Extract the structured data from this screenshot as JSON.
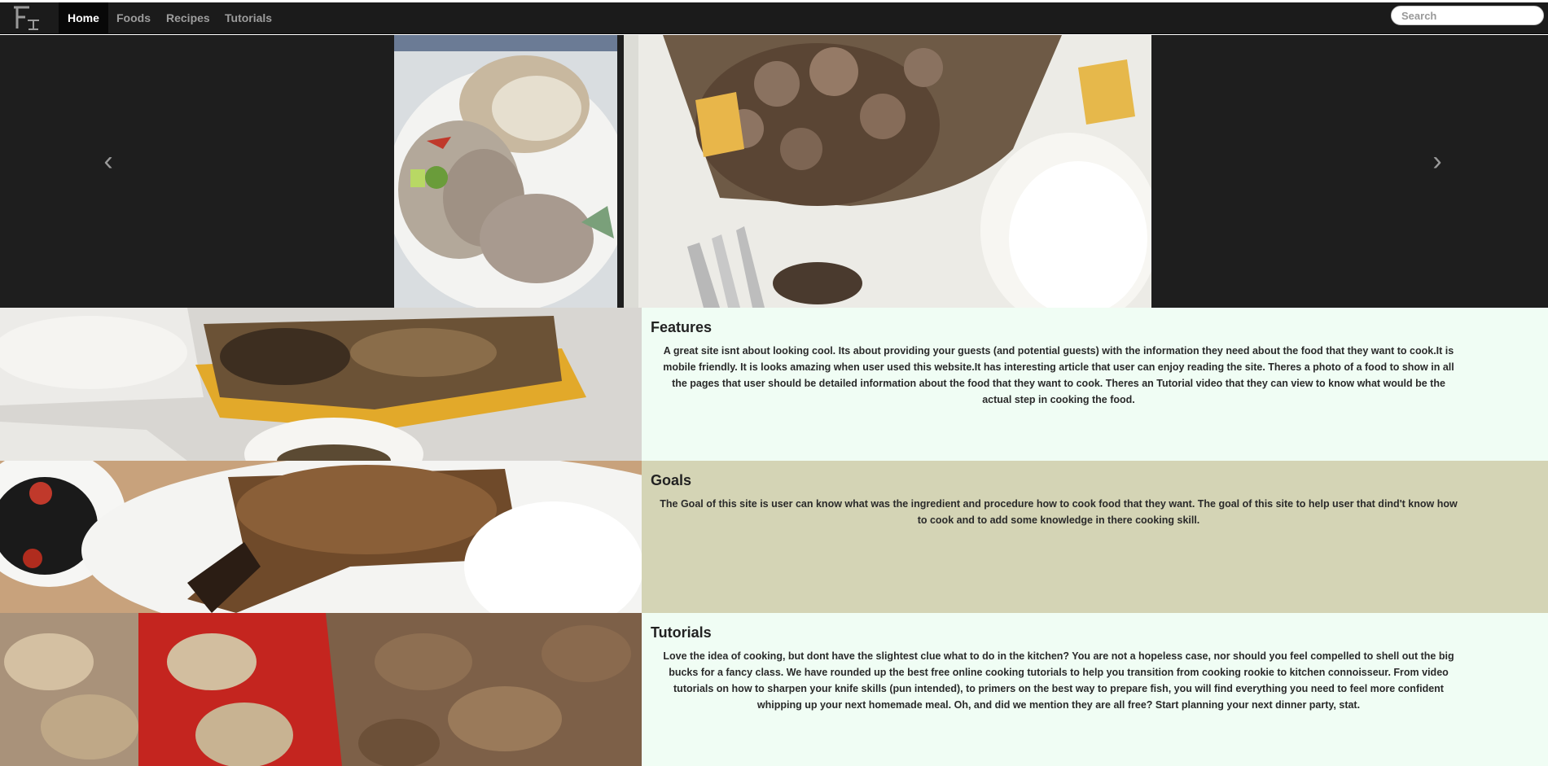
{
  "navbar": {
    "logo_icon": "fi-logo-icon",
    "items": [
      {
        "label": "Home",
        "active": true
      },
      {
        "label": "Foods",
        "active": false
      },
      {
        "label": "Recipes",
        "active": false
      },
      {
        "label": "Tutorials",
        "active": false
      }
    ],
    "search_placeholder": "Search"
  },
  "carousel": {
    "prev_icon": "chevron-left-icon",
    "next_icon": "chevron-right-icon",
    "prev_glyph": "‹",
    "next_glyph": "›",
    "indicator_count": 4,
    "active_index": 0
  },
  "sections": {
    "features": {
      "title": "Features",
      "text": "A great site isnt about looking cool. Its about providing your guests (and potential guests) with the information they need about the food that they want to cook.It is mobile friendly. It is looks amazing when user used this website.It has interesting article that user can enjoy reading the site. Theres a photo of a food to show in all the pages that user should be detailed information about the food that they want to cook. Theres an Tutorial video that they can view to know what would be the actual step in cooking the food."
    },
    "goals": {
      "title": "Goals",
      "text": "The Goal of this site is user can know what was the ingredient and procedure how to cook food that they want. The goal of this site to help user that dind't know how to cook and to add some knowledge in there cooking skill."
    },
    "tutorials": {
      "title": "Tutorials",
      "text": "Love the idea of cooking, but dont have the slightest clue what to do in the kitchen? You are not a hopeless case, nor should you feel compelled to shell out the big bucks for a fancy class. We have rounded up the best free online cooking tutorials to help you transition from cooking rookie to kitchen connoisseur. From video tutorials on how to sharpen your knife skills (pun intended), to primers on the best way to prepare fish, you will find everything you need to feel more confident whipping up your next homemade meal. Oh, and did we mention they are all free? Start planning your next dinner party, stat."
    }
  },
  "colors": {
    "navbar_bg": "#1b1b1b",
    "carousel_bg": "#1e1e1e",
    "section_light": "#f0fdf4",
    "section_olive": "#d4d4b5"
  }
}
